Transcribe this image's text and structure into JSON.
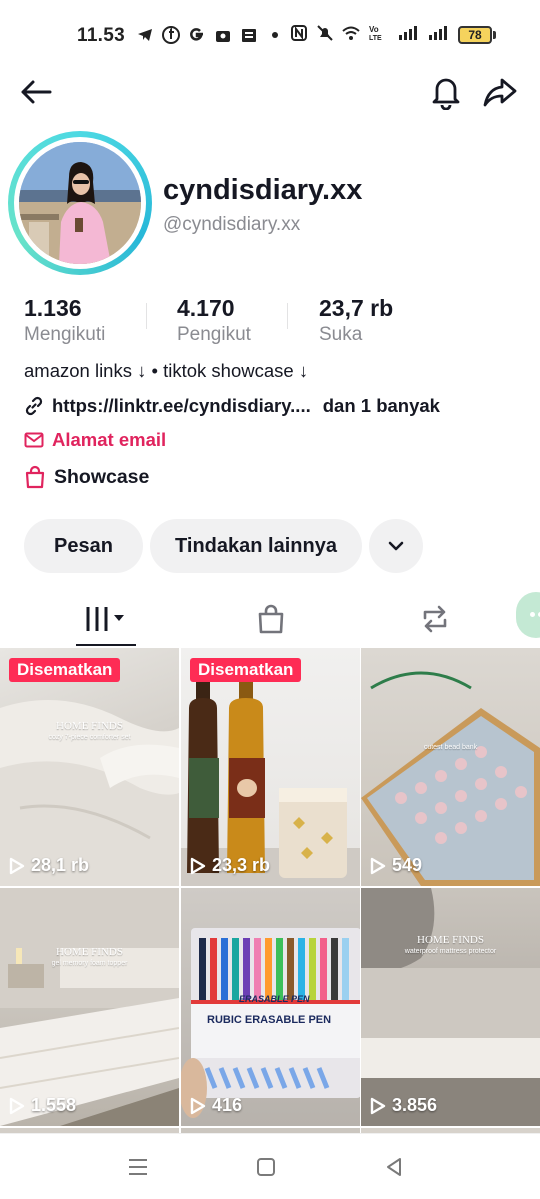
{
  "status_bar": {
    "time": "11.53",
    "battery": "78"
  },
  "profile": {
    "display_name": "cyndisdiary.xx",
    "username": "@cyndisdiary.xx",
    "stats": [
      {
        "value": "1.136",
        "label": "Mengikuti"
      },
      {
        "value": "4.170",
        "label": "Pengikut"
      },
      {
        "value": "23,7 rb",
        "label": "Suka"
      }
    ],
    "bio": "amazon links ↓ • tiktok showcase ↓",
    "link_text": "https://linktr.ee/cyndisdiary....",
    "link_more": "dan 1 banyak",
    "email_label": "Alamat email",
    "showcase_label": "Showcase"
  },
  "actions": {
    "message_label": "Pesan",
    "more_actions_label": "Tindakan lainnya"
  },
  "tabs": [
    {
      "icon": "videos-grid-icon",
      "active": true
    },
    {
      "icon": "shopping-bag-icon",
      "active": false
    },
    {
      "icon": "repost-icon",
      "active": false
    }
  ],
  "videos": [
    {
      "pinned_label": "Disematkan",
      "views": "28,1 rb",
      "overlay_title": "HOME FINDS",
      "overlay_sub": "cozy 7-piece comforter set"
    },
    {
      "pinned_label": "Disematkan",
      "views": "23,3 rb"
    },
    {
      "views": "549",
      "overlay_sub": "cutest bead bank"
    },
    {
      "views": "1.558",
      "overlay_title": "HOME FINDS",
      "overlay_sub": "gel memory foam topper"
    },
    {
      "views": "416",
      "overlay_brand": "ERASABLE PEN",
      "overlay_product": "RUBIC ERASABLE PEN"
    },
    {
      "views": "3.856",
      "overlay_title": "HOME FINDS",
      "overlay_sub": "waterproof mattress protector"
    }
  ],
  "colors": {
    "accent_red": "#fe2c55",
    "email_red": "#e0245e",
    "ring_teal": "#4dd9e3",
    "text_primary": "#161823",
    "text_secondary": "#8a8b91"
  }
}
